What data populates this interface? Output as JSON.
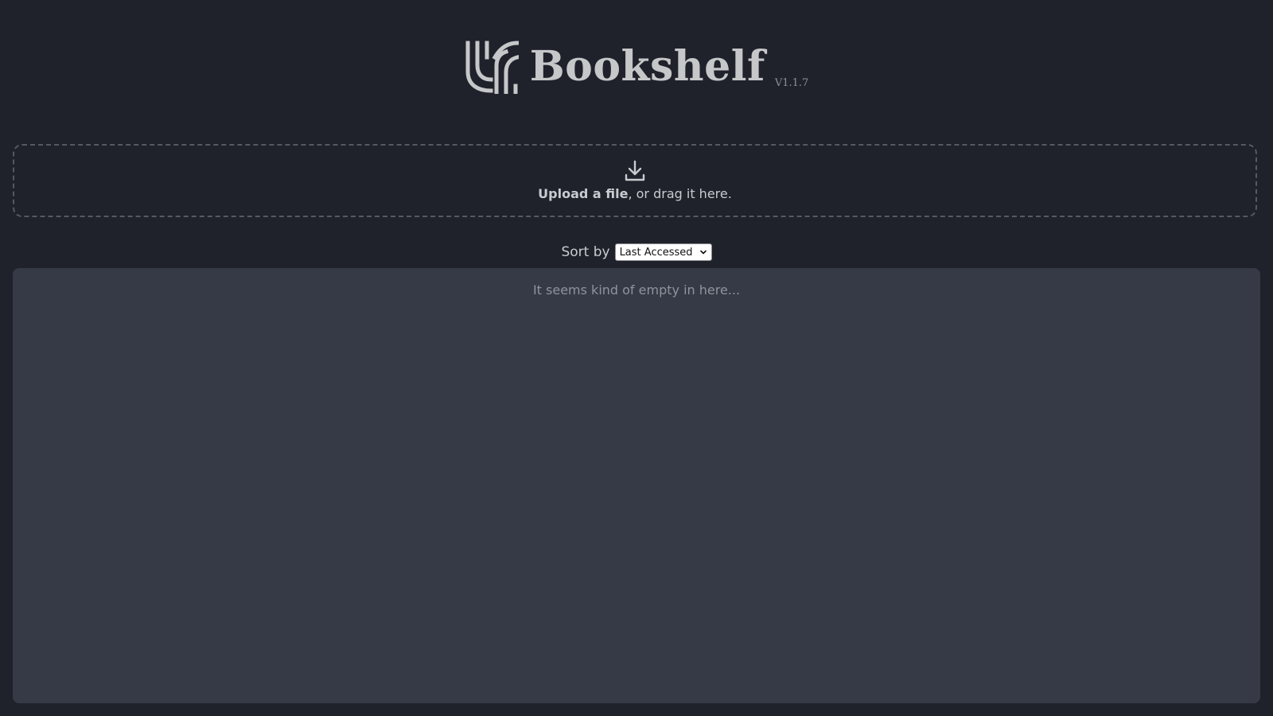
{
  "app": {
    "title": "Bookshelf",
    "version": "V1.1.7",
    "logo_icon": "bookshelf-logo-icon"
  },
  "upload": {
    "icon": "download-tray-icon",
    "action_label": "Upload a file",
    "rest_label": ", or drag it here."
  },
  "sort": {
    "label": "Sort by",
    "selected_value": "Last Accessed"
  },
  "library": {
    "empty_message": "It seems kind of empty in here..."
  },
  "colors": {
    "background": "#1f222b",
    "panel": "#363a46",
    "text": "#c9cbd0",
    "muted_text": "#8f939d"
  }
}
